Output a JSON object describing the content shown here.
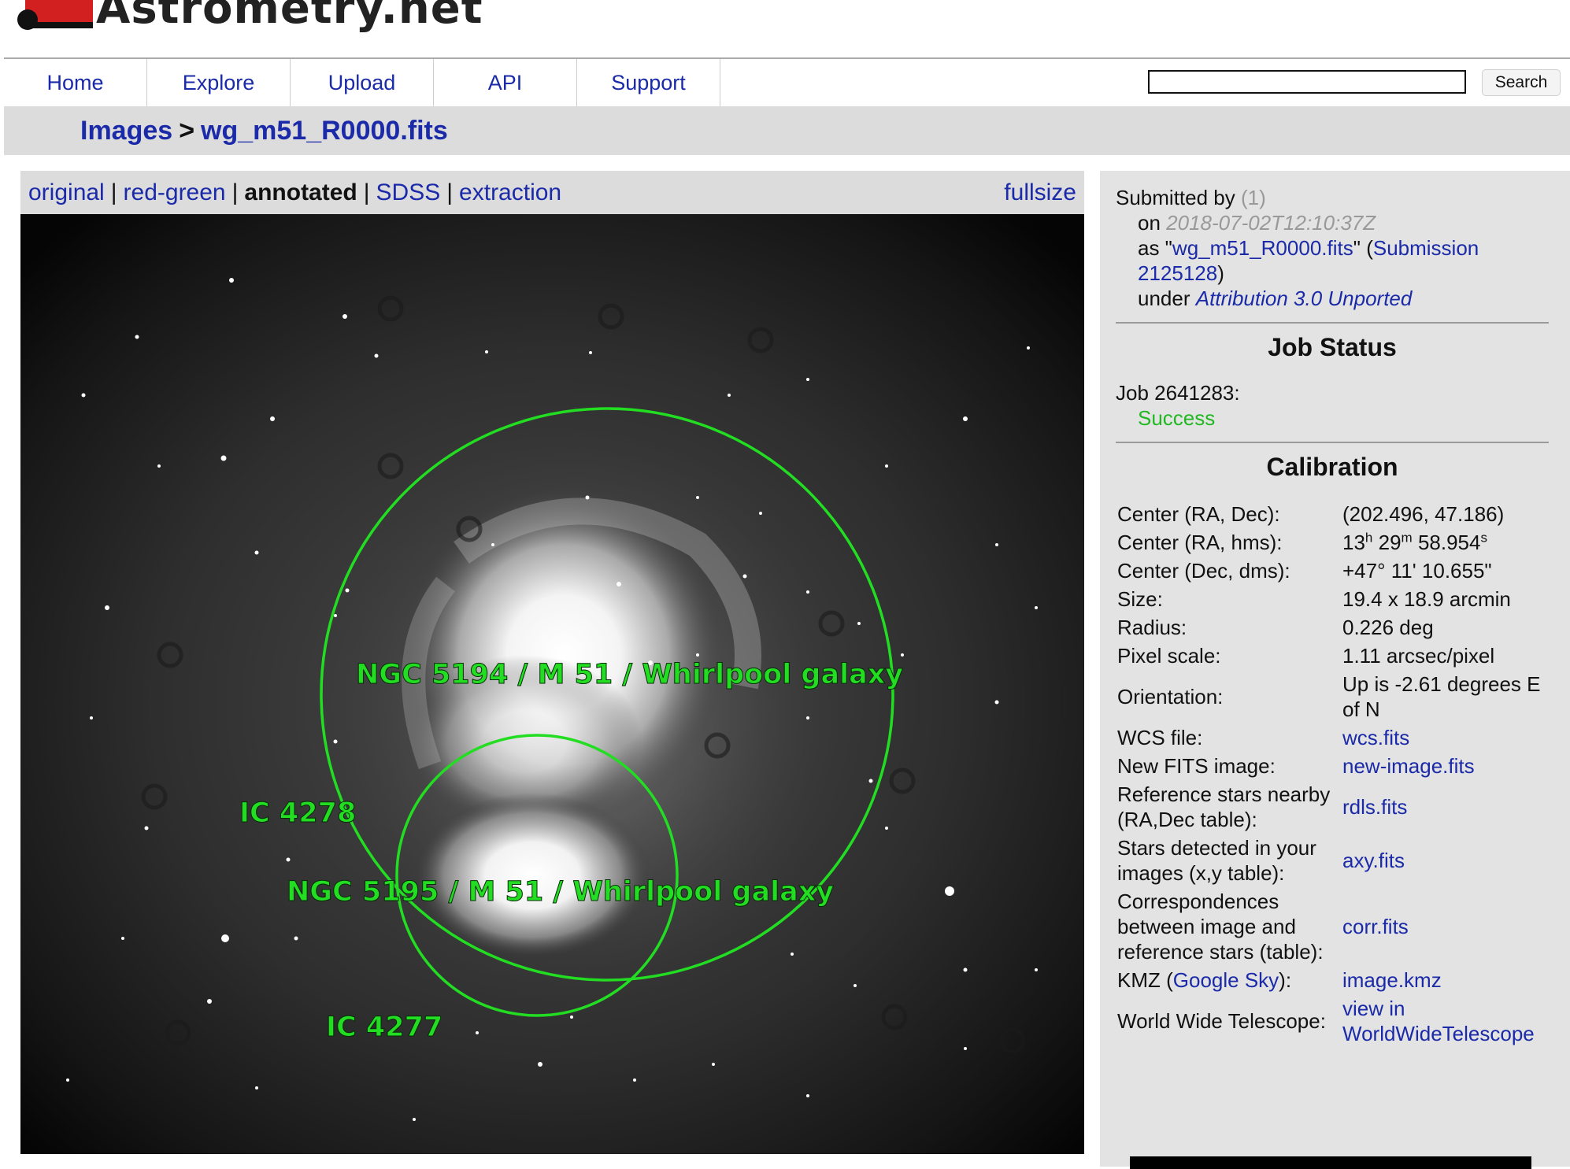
{
  "header": {
    "logo_text": "Astrometry.net"
  },
  "nav": {
    "tabs": [
      {
        "label": "Home"
      },
      {
        "label": "Explore"
      },
      {
        "label": "Upload"
      },
      {
        "label": "API"
      },
      {
        "label": "Support"
      }
    ],
    "search": {
      "value": "",
      "button_label": "Search"
    }
  },
  "breadcrumb": {
    "root": "Images",
    "separator": ">",
    "current": "wg_m51_R0000.fits"
  },
  "image_panel": {
    "view_links": {
      "original": "original",
      "red_green": "red-green",
      "annotated": "annotated",
      "sdss": "SDSS",
      "extraction": "extraction",
      "separator": "|"
    },
    "current_view": "annotated",
    "fullsize_label": "fullsize",
    "annotations": {
      "ngc5194": "NGC 5194 / M 51 / Whirlpool galaxy",
      "ngc5195": "NGC 5195 / M 51 / Whirlpool galaxy",
      "ic4278": "IC 4278",
      "ic4277": "IC 4277"
    },
    "annotation_color": "#22dd22"
  },
  "submission": {
    "submitted_by_label": "Submitted by",
    "submitted_by_value": "(1)",
    "on_label": "on",
    "date": "2018-07-02T12:10:37Z",
    "as_prefix": "as \"",
    "filename": "wg_m51_R0000.fits",
    "as_suffix": "\" (",
    "submission_link": "Submission 2125128",
    "close_paren": ")",
    "under_label": "under",
    "license": "Attribution 3.0 Unported"
  },
  "job_status": {
    "title": "Job Status",
    "job_label": "Job 2641283:",
    "status": "Success",
    "status_color": "#22b822"
  },
  "calibration": {
    "title": "Calibration",
    "center_radec": {
      "label": "Center (RA, Dec):",
      "value": "(202.496, 47.186)"
    },
    "center_hms": {
      "label": "Center (RA, hms):",
      "h": "13",
      "h_unit": "h",
      "m": "29",
      "m_unit": "m",
      "s": "58.954",
      "s_unit": "s"
    },
    "center_dms": {
      "label": "Center (Dec, dms):",
      "value": "+47° 11' 10.655\""
    },
    "size": {
      "label": "Size:",
      "value": "19.4 x 18.9 arcmin"
    },
    "radius": {
      "label": "Radius:",
      "value": "0.226 deg"
    },
    "pixel_scale": {
      "label": "Pixel scale:",
      "value": "1.11 arcsec/pixel"
    },
    "orientation": {
      "label": "Orientation:",
      "value": "Up is -2.61 degrees E of N"
    },
    "wcs_file": {
      "label": "WCS file:",
      "value": "wcs.fits"
    },
    "new_fits": {
      "label": "New FITS image:",
      "value": "new-image.fits"
    },
    "ref_stars": {
      "label": "Reference stars nearby (RA,Dec table):",
      "value": "rdls.fits"
    },
    "stars_detected": {
      "label": "Stars detected in your images (x,y table):",
      "value": "axy.fits"
    },
    "correspondences": {
      "label": "Correspondences between image and reference stars (table):",
      "value": "corr.fits"
    },
    "kmz": {
      "label_prefix": "KMZ (",
      "label_link": "Google Sky",
      "label_suffix": "):",
      "value": "image.kmz"
    },
    "wwt": {
      "label": "World Wide Telescope:",
      "value": "view in WorldWideTelescope"
    }
  }
}
